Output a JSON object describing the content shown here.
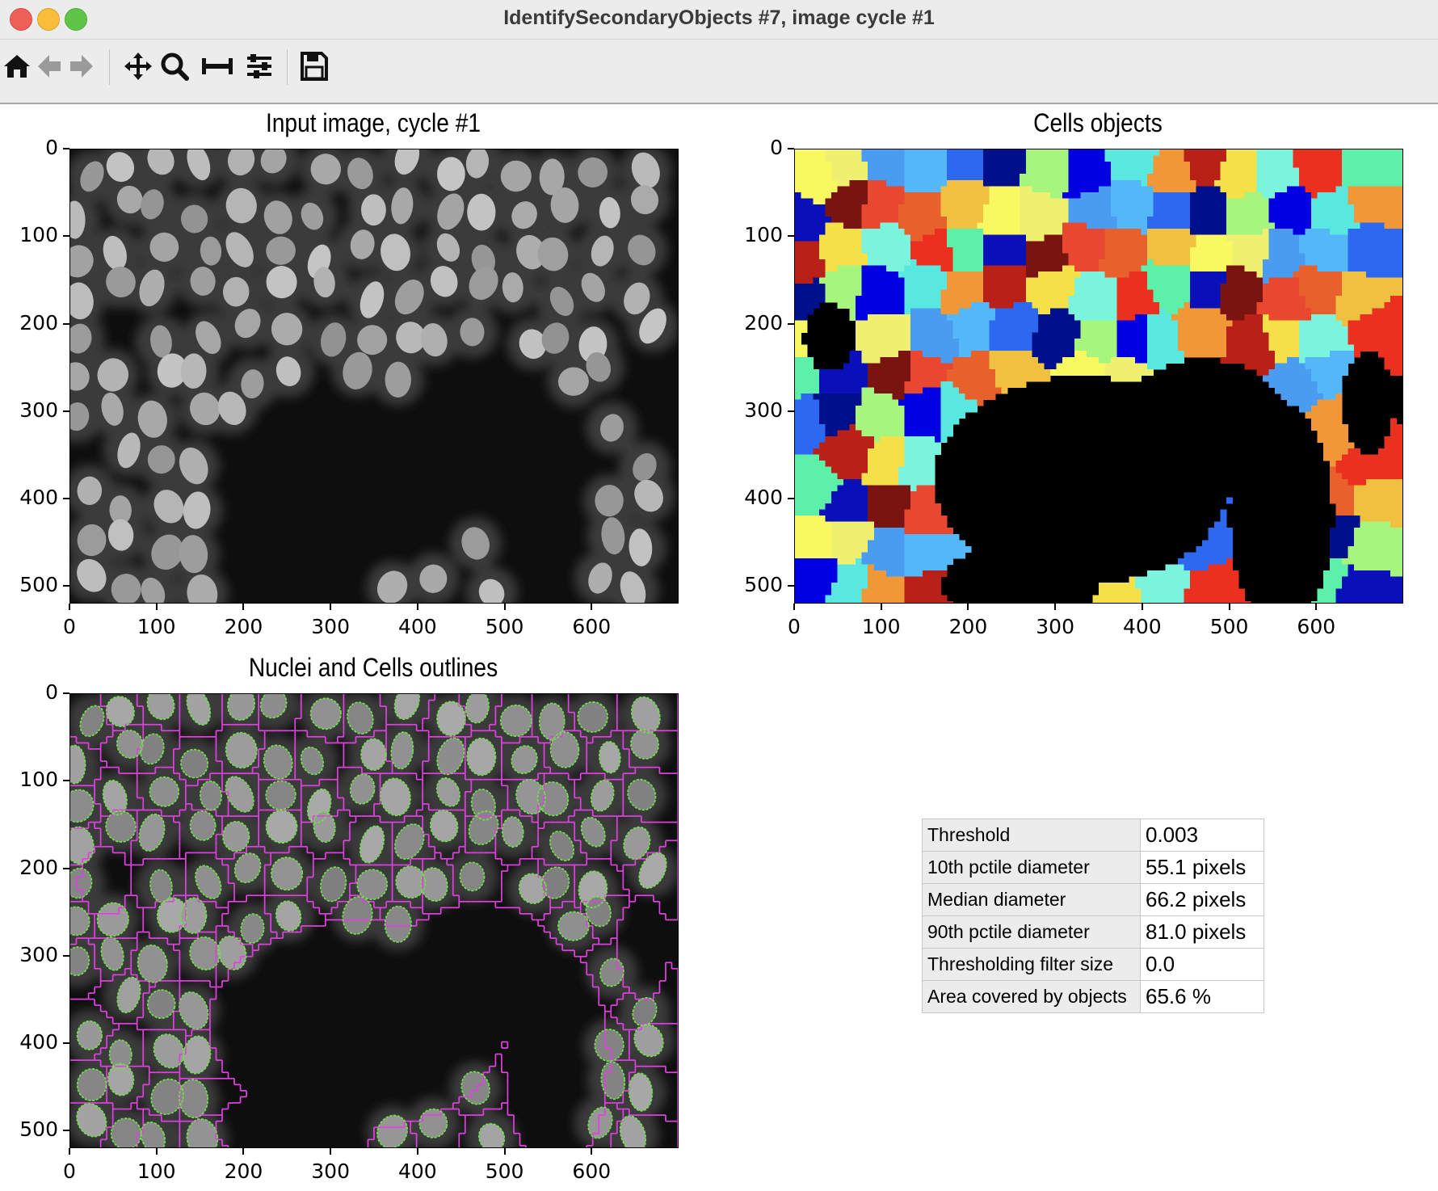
{
  "window": {
    "title": "IdentifySecondaryObjects #7, image cycle #1"
  },
  "toolbar": {
    "buttons": [
      {
        "name": "home-button",
        "icon": "home-icon"
      },
      {
        "name": "back-button",
        "icon": "arrow-left-icon"
      },
      {
        "name": "forward-button",
        "icon": "arrow-right-icon"
      },
      {
        "name": "pan-button",
        "icon": "move-icon"
      },
      {
        "name": "zoom-button",
        "icon": "zoom-icon"
      },
      {
        "name": "measure-button",
        "icon": "ruler-icon"
      },
      {
        "name": "configure-button",
        "icon": "sliders-icon"
      },
      {
        "name": "save-button",
        "icon": "save-icon"
      }
    ]
  },
  "panels": {
    "input": {
      "title": "Input image, cycle #1",
      "x_ticks": [
        "0",
        "100",
        "200",
        "300",
        "400",
        "500",
        "600"
      ],
      "y_ticks": [
        "0",
        "100",
        "200",
        "300",
        "400",
        "500"
      ]
    },
    "cells": {
      "title": "Cells objects",
      "x_ticks": [
        "0",
        "100",
        "200",
        "300",
        "400",
        "500",
        "600"
      ],
      "y_ticks": [
        "0",
        "100",
        "200",
        "300",
        "400",
        "500"
      ]
    },
    "outlines": {
      "title": "Nuclei and Cells outlines",
      "x_ticks": [
        "0",
        "100",
        "200",
        "300",
        "400",
        "500",
        "600"
      ],
      "y_ticks": [
        "0",
        "100",
        "200",
        "300",
        "400",
        "500"
      ]
    }
  },
  "image_extent": {
    "x": [
      0,
      700
    ],
    "y": [
      0,
      520
    ]
  },
  "colors": {
    "cell_outline": "#e040e0",
    "nucleus_outline": "#6ee04a",
    "background": "#000000",
    "label_palette": [
      "#f8f860",
      "#54b8f8",
      "#a6f67e",
      "#f09838",
      "#7af4dc",
      "#0a10b8",
      "#e8602c",
      "#f0f070",
      "#2c68f0",
      "#0000e0",
      "#b82018",
      "#ec3020",
      "#7a1410",
      "#f0c040",
      "#4a9cf0",
      "#00108a",
      "#58e8e0",
      "#f4e048",
      "#5cf0a8",
      "#e84830"
    ]
  },
  "stats": [
    {
      "label": "Threshold",
      "value": "0.003"
    },
    {
      "label": "10th pctile diameter",
      "value": "55.1 pixels"
    },
    {
      "label": "Median diameter",
      "value": "66.2 pixels"
    },
    {
      "label": "90th pctile diameter",
      "value": "81.0 pixels"
    },
    {
      "label": "Thresholding filter size",
      "value": "0.0"
    },
    {
      "label": "Area covered by objects",
      "value": "65.6 %"
    }
  ]
}
